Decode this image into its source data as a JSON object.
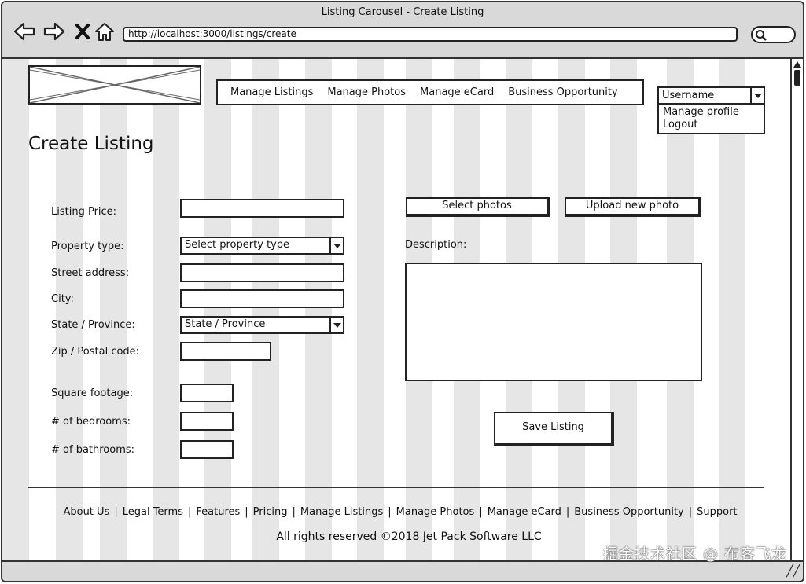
{
  "window": {
    "title": "Listing Carousel - Create Listing",
    "url": "http://localhost:3000/listings/create"
  },
  "nav": [
    "Manage Listings",
    "Manage Photos",
    "Manage eCard",
    "Business Opportunity"
  ],
  "user": {
    "selected": "Username",
    "menu": [
      "Manage profile",
      "Logout"
    ]
  },
  "page_title": "Create Listing",
  "form": {
    "listing_price_label": "Listing Price:",
    "property_type_label": "Property type:",
    "property_type_value": "Select property type",
    "street_label": "Street address:",
    "city_label": "City:",
    "state_label": "State / Province:",
    "state_value": "State / Province",
    "zip_label": "Zip / Postal code:",
    "sqft_label": "Square footage:",
    "bedrooms_label": "# of bedrooms:",
    "bathrooms_label": "# of bathrooms:",
    "description_label": "Description:"
  },
  "buttons": {
    "select_photos": "Select photos",
    "upload_photo": "Upload new photo",
    "save_listing": "Save Listing"
  },
  "footer": {
    "links": [
      "About Us",
      "Legal Terms",
      "Features",
      "Pricing",
      "Manage Listings",
      "Manage Photos",
      "Manage eCard",
      "Business Opportunity",
      "Support"
    ],
    "separator": "|",
    "copyright": "All rights reserved ©2018 Jet Pack Software LLC"
  },
  "watermark": "掘金技术社区 @ 布客飞龙",
  "colors": {
    "frame": "#333333",
    "chrome": "#d9d9d9",
    "column_stripe": "#e6e6e6"
  }
}
